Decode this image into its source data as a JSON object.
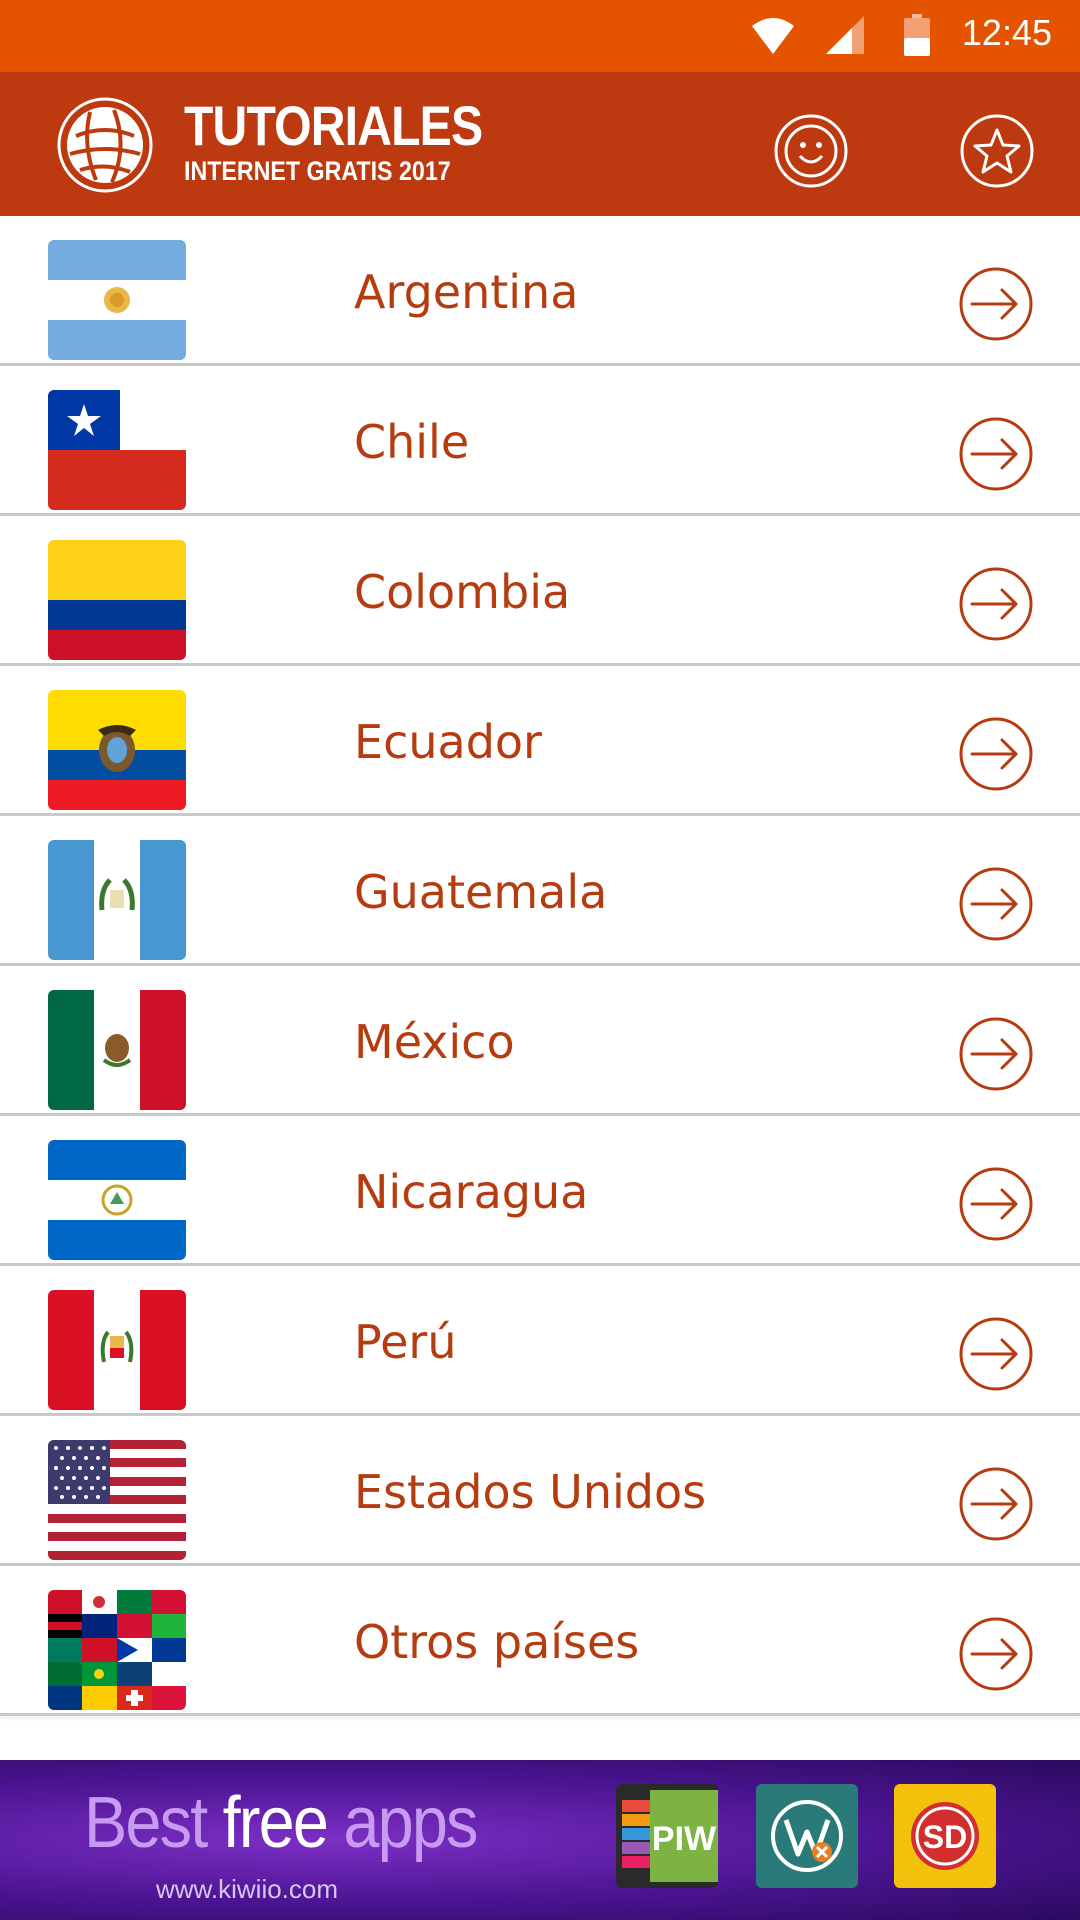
{
  "status_bar": {
    "time": "12:45",
    "background": "#e35300",
    "icons": [
      "wifi-icon",
      "cell-signal-icon",
      "battery-icon"
    ]
  },
  "app_bar": {
    "title": "TUTORIALES",
    "subtitle": "INTERNET GRATIS 2017",
    "background": "#bd3a10",
    "actions": [
      "smiley-icon",
      "star-icon"
    ]
  },
  "countries": [
    {
      "name": "Argentina",
      "flag": "argentina-flag"
    },
    {
      "name": "Chile",
      "flag": "chile-flag"
    },
    {
      "name": "Colombia",
      "flag": "colombia-flag"
    },
    {
      "name": "Ecuador",
      "flag": "ecuador-flag"
    },
    {
      "name": "Guatemala",
      "flag": "guatemala-flag"
    },
    {
      "name": "México",
      "flag": "mexico-flag"
    },
    {
      "name": "Nicaragua",
      "flag": "nicaragua-flag"
    },
    {
      "name": "Perú",
      "flag": "peru-flag"
    },
    {
      "name": "Estados Unidos",
      "flag": "usa-flag"
    },
    {
      "name": "Otros países",
      "flag": "world-flags"
    }
  ],
  "ad": {
    "title_part1": "Best ",
    "title_part2": "free",
    "title_part3": " apps",
    "url": "www.kiwiio.com",
    "apps": [
      "PIW",
      "W",
      "SD"
    ]
  },
  "colors": {
    "accent": "#b63c10",
    "divider": "#c9c9c9"
  }
}
